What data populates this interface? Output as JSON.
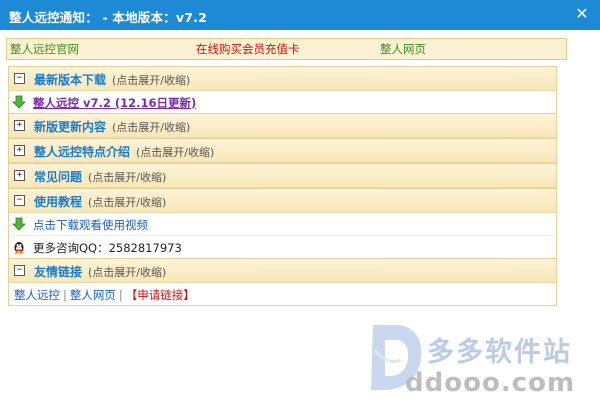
{
  "window": {
    "title": "整人远控通知： - 本地版本：v7.2",
    "close_glyph": "✕"
  },
  "linkbar": {
    "link1": "整人远控官网",
    "link2": "在线购买会员充值卡",
    "link3": "整人网页"
  },
  "sections": {
    "latest": {
      "toggle": "−",
      "title": "最新版本下载",
      "hint": "(点击展开/收缩)",
      "download_link": "整人远控  v7.2 (12.16日更新)",
      "icon": "green-down-arrow-icon"
    },
    "updates": {
      "toggle": "+",
      "title": "新版更新内容",
      "hint": "(点击展开/收缩)"
    },
    "features": {
      "toggle": "+",
      "title": "整人远控特点介绍",
      "hint": "(点击展开/收缩)"
    },
    "faq": {
      "toggle": "+",
      "title": "常见问题",
      "hint": "(点击展开/收缩)"
    },
    "tutorial": {
      "toggle": "−",
      "title": "使用教程",
      "hint": "(点击展开/收缩)",
      "video_link": "点击下载观看使用视频",
      "qq_text": "更多咨询QQ：2582817973"
    },
    "friends": {
      "toggle": "−",
      "title": "友情链接",
      "hint": "(点击展开/收缩)",
      "link1": "整人远控",
      "link2": "整人网页",
      "link3": "【申请链接】",
      "separator": "|"
    }
  },
  "watermark": {
    "text_cn": "多多软件站",
    "text_en": "ddooo.com"
  },
  "colors": {
    "titlebar": "#1e8ad6",
    "section_title": "#1b7ccc",
    "link_red": "#d01010",
    "link_green": "#3a8f20"
  }
}
